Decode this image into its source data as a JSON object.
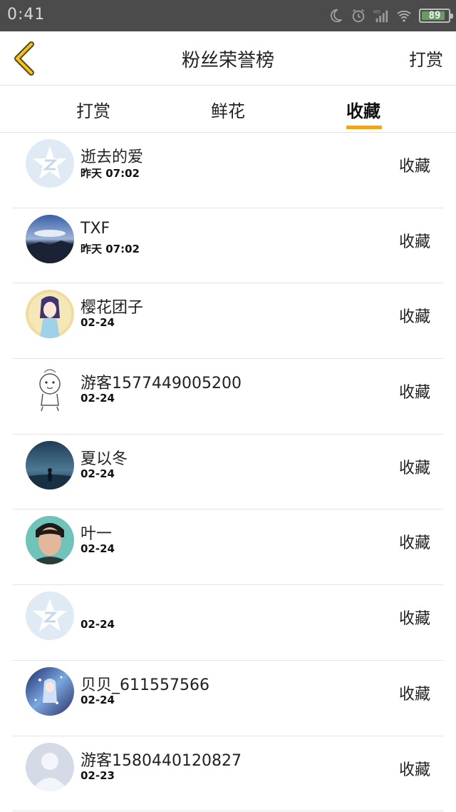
{
  "status_bar": {
    "time": "0:41",
    "battery": "89",
    "battery_level": 0.89,
    "icons": [
      "moon-icon",
      "alarm-icon",
      "signal-icon",
      "wifi-icon",
      "battery-icon"
    ]
  },
  "header": {
    "title": "粉丝荣誉榜",
    "action_label": "打赏"
  },
  "tabs": [
    {
      "label": "打赏",
      "active": false
    },
    {
      "label": "鲜花",
      "active": false
    },
    {
      "label": "收藏",
      "active": true
    }
  ],
  "accent_color": "#f0a31e",
  "rows": [
    {
      "name": "逝去的爱",
      "time": "昨天 07:02",
      "action": "收藏",
      "avatar": "default-qq-avatar"
    },
    {
      "name": "TXF",
      "time": "昨天 07:02",
      "action": "收藏",
      "avatar": "landscape-avatar"
    },
    {
      "name": "樱花团子",
      "time": "02-24",
      "action": "收藏",
      "avatar": "anime-girl-avatar"
    },
    {
      "name": "游客1577449005200",
      "time": "02-24",
      "action": "收藏",
      "avatar": "cartoon-sketch-avatar"
    },
    {
      "name": "夏以冬",
      "time": "02-24",
      "action": "收藏",
      "avatar": "night-sky-avatar"
    },
    {
      "name": "叶一",
      "time": "02-24",
      "action": "收藏",
      "avatar": "person-photo-avatar"
    },
    {
      "name": "",
      "time": "02-24",
      "action": "收藏",
      "avatar": "default-qq-avatar"
    },
    {
      "name": "贝贝_611557566",
      "time": "02-24",
      "action": "收藏",
      "avatar": "anime-blue-avatar"
    },
    {
      "name": "游客1580440120827",
      "time": "02-23",
      "action": "收藏",
      "avatar": "default-person-avatar"
    }
  ]
}
